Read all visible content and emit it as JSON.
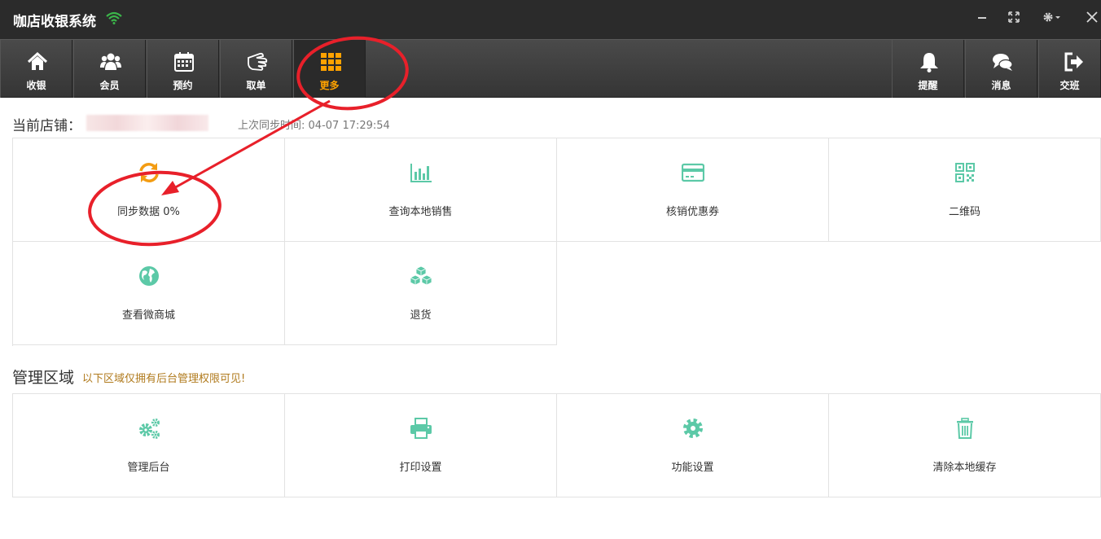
{
  "window": {
    "title": "咖店收银系统",
    "controls": [
      "minimize",
      "fullscreen",
      "settings",
      "close"
    ]
  },
  "toolbar": {
    "left": [
      {
        "label": "收银",
        "icon": "home-icon"
      },
      {
        "label": "会员",
        "icon": "users-icon"
      },
      {
        "label": "预约",
        "icon": "calendar-icon"
      },
      {
        "label": "取单",
        "icon": "hand-icon"
      },
      {
        "label": "更多",
        "icon": "grid-icon",
        "active": true
      }
    ],
    "right": [
      {
        "label": "提醒",
        "icon": "bell-icon"
      },
      {
        "label": "消息",
        "icon": "chat-icon"
      },
      {
        "label": "交班",
        "icon": "logout-icon"
      }
    ]
  },
  "store": {
    "label": "当前店铺：",
    "sync_label": "上次同步时间:",
    "sync_time": "04-07 17:29:54"
  },
  "features": [
    {
      "label": "同步数据 0%",
      "icon": "sync-icon",
      "color": "#f39c12"
    },
    {
      "label": "查询本地销售",
      "icon": "bar-chart-icon",
      "color": "#5cc9a7"
    },
    {
      "label": "核销优惠券",
      "icon": "card-icon",
      "color": "#5cc9a7"
    },
    {
      "label": "二维码",
      "icon": "qrcode-icon",
      "color": "#5cc9a7"
    },
    {
      "label": "查看微商城",
      "icon": "globe-icon",
      "color": "#5cc9a7"
    },
    {
      "label": "退货",
      "icon": "cubes-icon",
      "color": "#5cc9a7"
    }
  ],
  "admin": {
    "title": "管理区域",
    "note": "以下区域仅拥有后台管理权限可见!",
    "items": [
      {
        "label": "管理后台",
        "icon": "gears-icon"
      },
      {
        "label": "打印设置",
        "icon": "printer-icon"
      },
      {
        "label": "功能设置",
        "icon": "gear-icon"
      },
      {
        "label": "清除本地缓存",
        "icon": "trash-icon"
      }
    ]
  },
  "colors": {
    "accent": "#ffa200",
    "icon_green": "#5cc9a7",
    "annotation_red": "#e8202a"
  }
}
